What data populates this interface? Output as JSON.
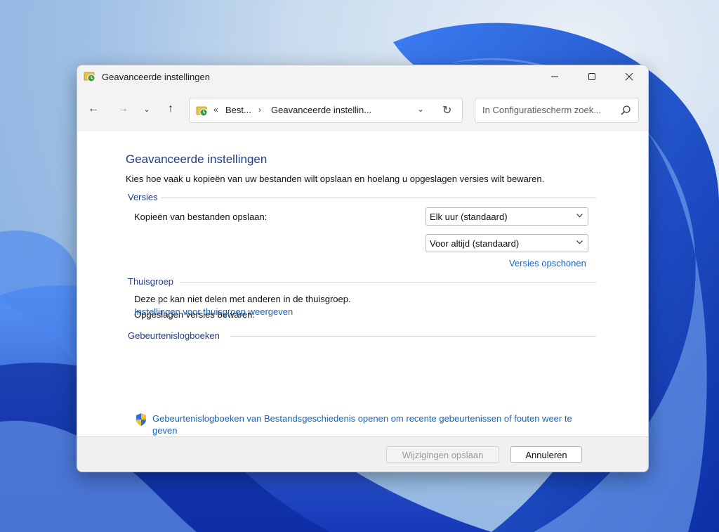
{
  "window": {
    "title": "Geavanceerde instellingen",
    "controls": {
      "minimize": "—",
      "maximize": "☐",
      "close": "✕"
    }
  },
  "navigation": {
    "back": "←",
    "forward": "→",
    "recent": "⌄",
    "up": "↑",
    "address": {
      "overflow_chevron": "«",
      "crumbs": [
        "Best...",
        "Geavanceerde instellin..."
      ],
      "separator": "›",
      "dropdown": "⌄",
      "refresh": "↻"
    },
    "search": {
      "placeholder": "In Configuratiescherm zoek..."
    }
  },
  "content": {
    "heading": "Geavanceerde instellingen",
    "description": "Kies hoe vaak u kopieën van uw bestanden wilt opslaan en hoelang u opgeslagen versies wilt bewaren.",
    "versions": {
      "label": "Versies",
      "copies": {
        "label": "Kopieën van bestanden opslaan:",
        "value": "Elk uur (standaard)"
      },
      "keep": {
        "label": "Opgeslagen versies bewaren:",
        "value": "Voor altijd (standaard)"
      },
      "cleanup_link": "Versies opschonen"
    },
    "homegroup": {
      "label": "Thuisgroep",
      "text": "Deze pc kan niet delen met anderen in de thuisgroep.",
      "link": "Instellingen voor thuisgroep weergeven"
    },
    "eventlogs": {
      "label": "Gebeurtenislogboeken",
      "link": "Gebeurtenislogboeken van Bestandsgeschiedenis openen om recente gebeurtenissen of fouten weer te geven"
    }
  },
  "footer": {
    "save_label": "Wijzigingen opslaan",
    "cancel_label": "Annuleren"
  },
  "colors": {
    "accent_heading": "#1e3e8a",
    "link": "#1565c0",
    "wallpaper_blue": "#1f4fd1"
  },
  "icons": {
    "app": "file-history-icon",
    "shield": "uac-shield-icon",
    "search": "search-icon"
  }
}
